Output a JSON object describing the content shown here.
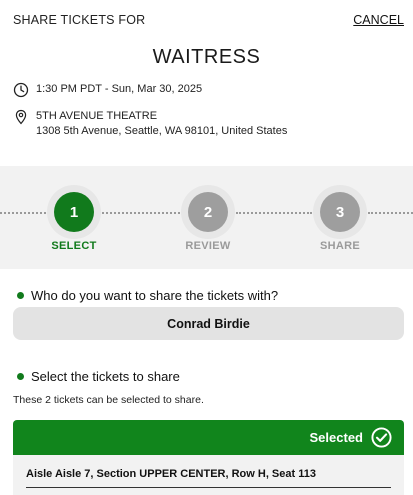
{
  "header": {
    "title": "SHARE TICKETS FOR",
    "cancel_label": "CANCEL"
  },
  "event": {
    "name": "WAITRESS",
    "datetime": "1:30 PM PDT - Sun, Mar 30, 2025",
    "venue_name": "5TH AVENUE THEATRE",
    "venue_address": "1308 5th Avenue, Seattle, WA 98101, United States"
  },
  "stepper": {
    "steps": [
      {
        "number": "1",
        "label": "SELECT",
        "state": "active"
      },
      {
        "number": "2",
        "label": "REVIEW",
        "state": "inactive"
      },
      {
        "number": "3",
        "label": "SHARE",
        "state": "inactive"
      }
    ]
  },
  "recipient": {
    "question": "Who do you want to share the tickets with?",
    "name": "Conrad Birdie"
  },
  "tickets": {
    "question": "Select the tickets to share",
    "subtext": "These 2 tickets can be selected to share.",
    "selected_label": "Selected",
    "seat": "Aisle Aisle 7, Section UPPER CENTER, Row H, Seat 113"
  },
  "colors": {
    "accent": "#117a1c",
    "inactive": "#9e9e9e",
    "panel": "#f2f2f2"
  },
  "icons": {
    "time": "clock-icon",
    "venue": "location-pin-icon",
    "bullet": "green-dot-icon",
    "selected": "check-circle-icon"
  }
}
